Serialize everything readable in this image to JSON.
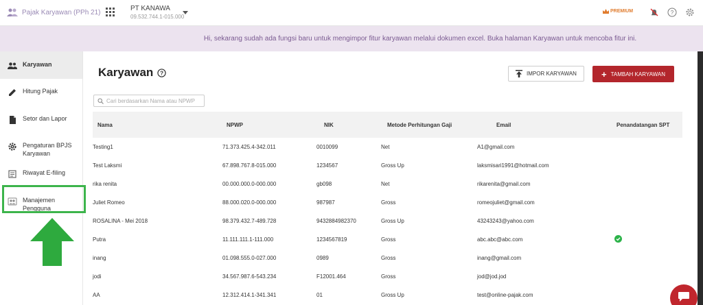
{
  "app": {
    "name": "Pajak Karyawan (PPh 21)"
  },
  "company": {
    "name": "PT KANAWA",
    "npwp": "09.532.744.1-015.000"
  },
  "header": {
    "premium_label": "PREMIUM"
  },
  "banner": {
    "text": "Hi, sekarang sudah ada fungsi baru untuk mengimpor fitur karyawan melalui dokumen excel. Buka halaman Karyawan untuk mencoba fitur ini."
  },
  "sidebar": {
    "items": [
      {
        "label": "Karyawan",
        "icon": "people-icon",
        "active": true
      },
      {
        "label": "Hitung Pajak",
        "icon": "pencil-icon"
      },
      {
        "label": "Setor dan Lapor",
        "icon": "document-icon"
      },
      {
        "label": "Pengaturan BPJS Karyawan",
        "icon": "gear-icon"
      },
      {
        "label": "Riwayat E-filing",
        "icon": "history-icon"
      },
      {
        "label": "Manajemen Pengguna",
        "icon": "users-icon"
      }
    ]
  },
  "main": {
    "title": "Karyawan",
    "impor_label": "IMPOR KARYAWAN",
    "tambah_label": "TAMBAH KARYAWAN",
    "search_placeholder": "Cari berdasarkan Nama atau NPWP"
  },
  "table": {
    "headers": [
      "Nama",
      "NPWP",
      "NIK",
      "Metode Perhitungan Gaji",
      "Email",
      "Penandatangan SPT"
    ],
    "rows": [
      {
        "nama": "Testing1",
        "npwp": "71.373.425.4-342.011",
        "nik": "0010099",
        "metode": "Net",
        "email": "A1@gmail.com",
        "spt": false
      },
      {
        "nama": "Test Laksmi",
        "npwp": "67.898.767.8-015.000",
        "nik": "1234567",
        "metode": "Gross Up",
        "email": "laksmisari1991@hotmail.com",
        "spt": false
      },
      {
        "nama": "rika renita",
        "npwp": "00.000.000.0-000.000",
        "nik": "gb098",
        "metode": "Net",
        "email": "rikarenita@gmail.com",
        "spt": false
      },
      {
        "nama": "Juliet Romeo",
        "npwp": "88.000.020.0-000.000",
        "nik": "987987",
        "metode": "Gross",
        "email": "romeojuliet@gmail.com",
        "spt": false
      },
      {
        "nama": "ROSALINA - Mei 2018",
        "npwp": "98.379.432.7-489.728",
        "nik": "9432884982370",
        "metode": "Gross Up",
        "email": "43243243@yahoo.com",
        "spt": false
      },
      {
        "nama": "Putra",
        "npwp": "11.111.111.1-111.000",
        "nik": "1234567819",
        "metode": "Gross",
        "email": "abc.abc@abc.com",
        "spt": true
      },
      {
        "nama": "inang",
        "npwp": "01.098.555.0-027.000",
        "nik": "0989",
        "metode": "Gross",
        "email": "inang@gmail.com",
        "spt": false
      },
      {
        "nama": "jodi",
        "npwp": "34.567.987.6-543.234",
        "nik": "F12001.464",
        "metode": "Gross",
        "email": "jod@jod.jod",
        "spt": false
      },
      {
        "nama": "AA",
        "npwp": "12.312.414.1-341.341",
        "nik": "01",
        "metode": "Gross Up",
        "email": "test@online-pajak.com",
        "spt": false
      }
    ]
  },
  "colors": {
    "accent": "#b3262c",
    "banner_bg": "#ece3ef",
    "highlight": "#3cb44b",
    "check": "#2db34a"
  }
}
